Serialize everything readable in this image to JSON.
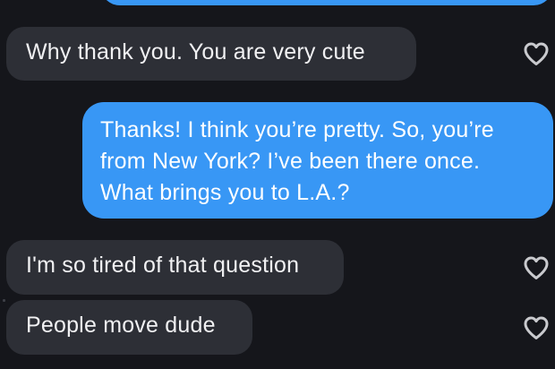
{
  "conversation": {
    "messages": [
      {
        "direction": "incoming",
        "text": "Why thank you. You are very cute",
        "like_icon": "heart-outline-icon"
      },
      {
        "direction": "outgoing",
        "lines": [
          "Thanks! I think you’re pretty. So, you’re",
          "from New York? I’ve been there once.",
          "What brings you to L.A.?"
        ]
      },
      {
        "direction": "incoming",
        "text": "I'm so tired of that question",
        "like_icon": "heart-outline-icon"
      },
      {
        "direction": "incoming",
        "text": "People move dude",
        "like_icon": "heart-outline-icon"
      }
    ]
  },
  "colors": {
    "background": "#15161b",
    "incoming_bubble": "#2d2f36",
    "outgoing_bubble": "#3897f5",
    "heart_outline": "#c9cace"
  }
}
